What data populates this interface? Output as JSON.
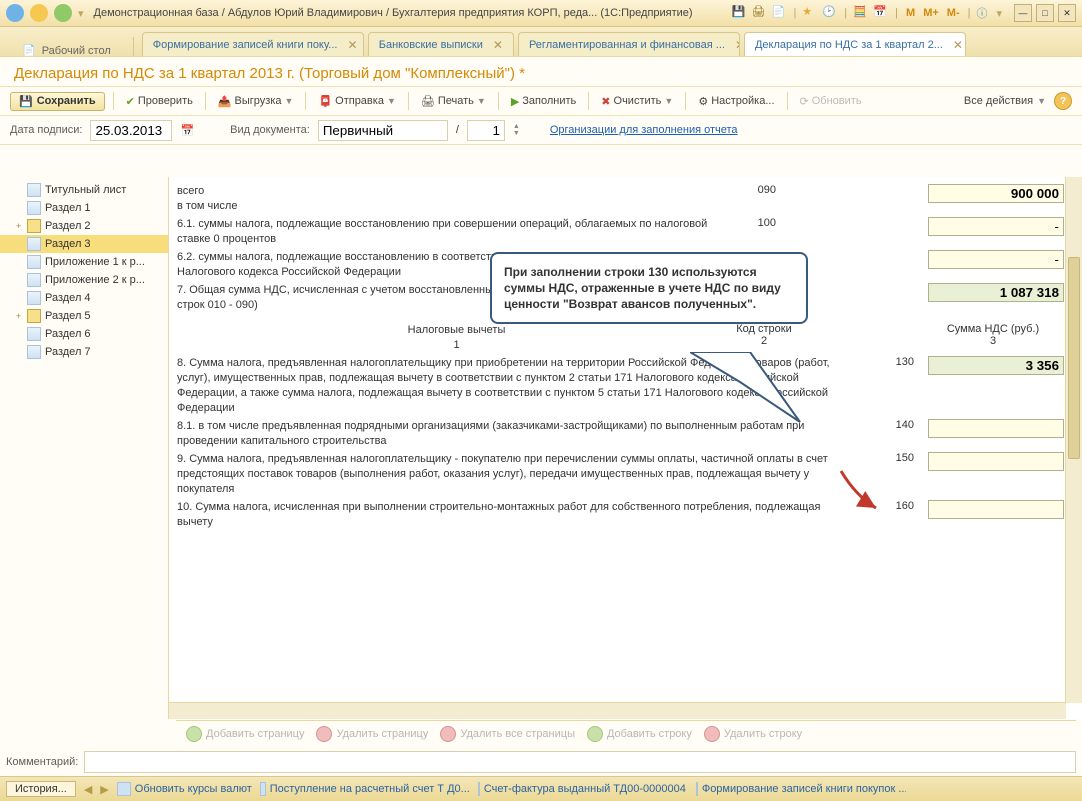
{
  "titlebar": {
    "text": "Демонстрационная база / Абдулов Юрий Владимирович / Бухгалтерия предприятия КОРП, реда...   (1С:Предприятие)",
    "m_labels": [
      "M",
      "M+",
      "M-"
    ]
  },
  "tabs": {
    "desk": "Рабочий стол",
    "items": [
      "Формирование записей книги поку...",
      "Банковские выписки",
      "Регламентированная и финансовая ...",
      "Декларация по НДС за 1 квартал 2..."
    ]
  },
  "doc_title": "Декларация по НДС за 1 квартал 2013 г. (Торговый дом \"Комплексный\") *",
  "toolbar": {
    "save": "Сохранить",
    "check": "Проверить",
    "upload": "Выгрузка",
    "send": "Отправка",
    "print": "Печать",
    "fill": "Заполнить",
    "clear": "Очистить",
    "settings": "Настройка...",
    "refresh": "Обновить",
    "all_actions": "Все действия"
  },
  "row2": {
    "date_label": "Дата подписи:",
    "date_value": "25.03.2013",
    "doc_type_label": "Вид документа:",
    "doc_type_value": "Первичный",
    "slash": "/",
    "page_value": "1",
    "org_link": "Организации для заполнения отчета"
  },
  "tree": [
    {
      "label": "Титульный лист",
      "type": "doc",
      "level": 1
    },
    {
      "label": "Раздел 1",
      "type": "doc",
      "level": 1
    },
    {
      "label": "Раздел 2",
      "type": "fold",
      "level": 1,
      "exp": "+"
    },
    {
      "label": "Раздел 3",
      "type": "doc",
      "level": 1,
      "sel": true
    },
    {
      "label": "Приложение 1 к р...",
      "type": "doc",
      "level": 1
    },
    {
      "label": "Приложение 2 к р...",
      "type": "doc",
      "level": 1
    },
    {
      "label": "Раздел 4",
      "type": "doc",
      "level": 1
    },
    {
      "label": "Раздел 5",
      "type": "fold",
      "level": 1,
      "exp": "+"
    },
    {
      "label": "Раздел 6",
      "type": "doc",
      "level": 1
    },
    {
      "label": "Раздел 7",
      "type": "doc",
      "level": 1
    }
  ],
  "form": {
    "r_total": {
      "desc": "всего",
      "sub": "в том числе",
      "code": "090",
      "value": "900 000"
    },
    "r61": {
      "desc": "6.1. суммы налога, подлежащие восстановлению при совершении операций, облагаемых по налоговой ставке 0 процентов",
      "code": "100",
      "value": "-"
    },
    "r62": {
      "desc": "6.2. суммы налога, подлежащие восстановлению в соответствии с подпунктом 3 пункта 3 статьи 170 Налогового кодекса Российской Федерации",
      "code": "",
      "value": "-"
    },
    "r7": {
      "desc": "7. Общая сумма НДС, исчисленная с учетом восстановленных сумм налога (сумма величин графы 5 строк 010 - 090)",
      "code": "",
      "value": "1 087 318"
    },
    "head": {
      "c1": "Налоговые вычеты",
      "c2": "Код строки",
      "c3": "Сумма НДС (руб.)",
      "n1": "1",
      "n2": "2",
      "n3": "3"
    },
    "r8": {
      "desc": "8. Сумма налога, предъявленная налогоплательщику при приобретении на территории Российской Федерации товаров (работ, услуг), имущественных прав, подлежащая вычету в соответствии с пунктом 2 статьи 171 Налогового кодекса Российской Федерации, а также сумма налога, подлежащая вычету в соответствии с пунктом 5 статьи 171 Налогового кодекса Российской Федерации",
      "code": "130",
      "value": "3 356"
    },
    "r81": {
      "desc": "8.1. в том числе предъявленная подрядными организациями (заказчиками-застройщиками) по выполненным работам при проведении капитального строительства",
      "code": "140",
      "value": ""
    },
    "r9": {
      "desc": "9. Сумма налога, предъявленная налогоплательщику - покупателю при перечислении суммы оплаты, частичной оплаты в счет предстоящих поставок товаров (выполнения работ, оказания услуг), передачи имущественных прав, подлежащая вычету у покупателя",
      "code": "150",
      "value": ""
    },
    "r10": {
      "desc": "10. Сумма налога, исчисленная при выполнении строительно-монтажных работ для собственного потребления, подлежащая вычету",
      "code": "160",
      "value": ""
    }
  },
  "callout": "При заполнении строки 130 используются суммы НДС, отраженные в учете НДС по виду ценности \"Возврат авансов полученных\".",
  "footer_btns": {
    "add_page": "Добавить страницу",
    "del_page": "Удалить страницу",
    "del_all": "Удалить все страницы",
    "add_row": "Добавить строку",
    "del_row": "Удалить строку"
  },
  "comment_label": "Комментарий:",
  "statusbar": {
    "history": "История...",
    "items": [
      "Обновить курсы валют",
      "Поступление на расчетный счет Т Д0...",
      "Счет-фактура выданный ТД00-0000004 о...",
      "Формирование записей книги покупок ..."
    ]
  }
}
